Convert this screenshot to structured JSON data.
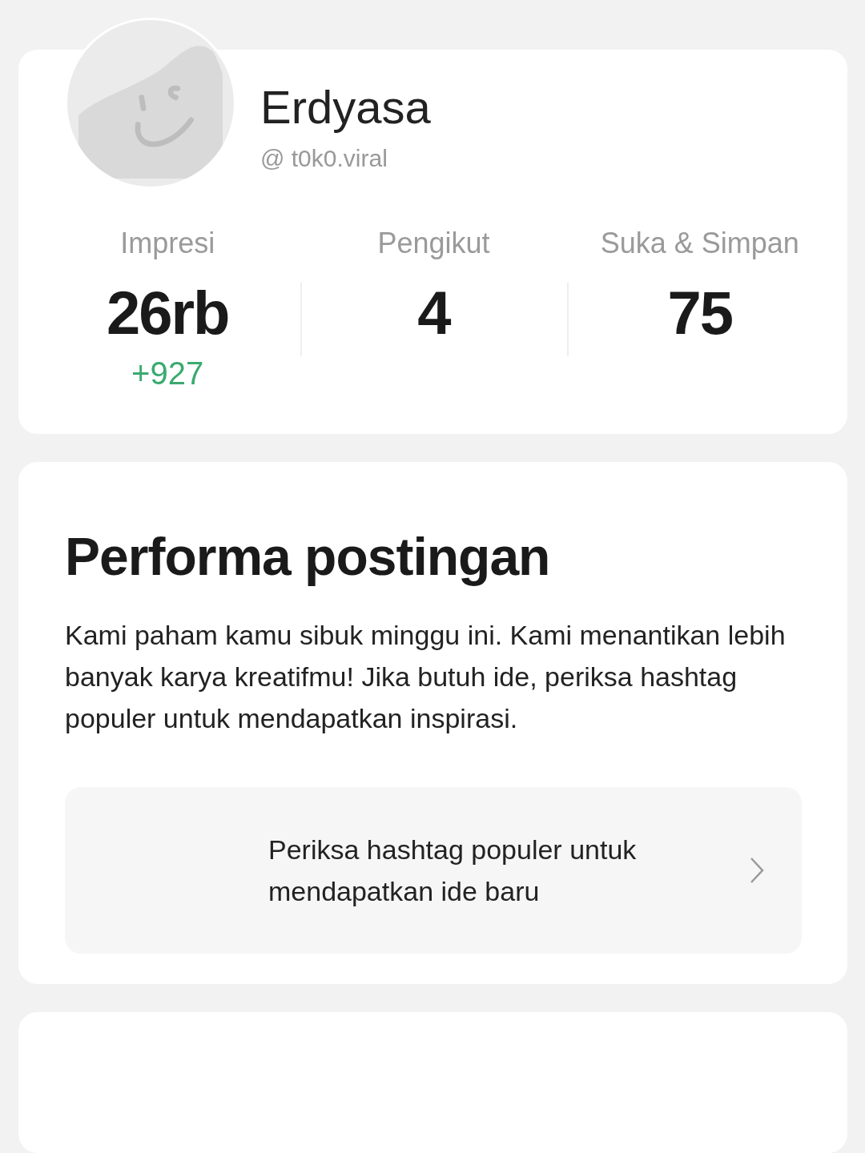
{
  "profile": {
    "name": "Erdyasa",
    "handle": "@ t0k0.viral"
  },
  "stats": [
    {
      "label": "Impresi",
      "value": "26rb",
      "change": "+927"
    },
    {
      "label": "Pengikut",
      "value": "4"
    },
    {
      "label": "Suka & Simpan",
      "value": "75"
    }
  ],
  "performance": {
    "title": "Performa postingan",
    "description": "Kami paham kamu sibuk minggu ini. Kami menantikan lebih banyak karya kreatifmu! Jika butuh ide, periksa hashtag populer untuk mendapatkan inspirasi.",
    "link": "Periksa hashtag populer untuk mendapatkan ide baru"
  }
}
